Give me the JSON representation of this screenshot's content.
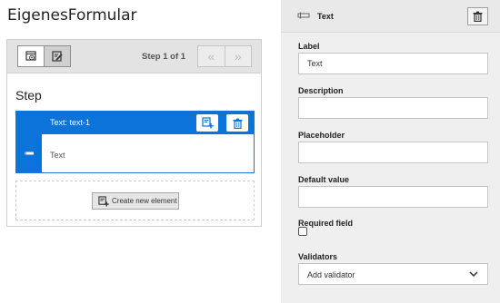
{
  "form": {
    "title": "EigenesFormular"
  },
  "stage": {
    "step_counter": "Step 1 of 1",
    "prev_label": "«",
    "next_label": "»",
    "step_title": "Step",
    "element": {
      "label": "Text: text-1",
      "value": "Text"
    },
    "create_button": "Create new element"
  },
  "inspector": {
    "title": "Text",
    "fields": {
      "label": {
        "label": "Label",
        "value": "Text"
      },
      "description": {
        "label": "Description",
        "value": ""
      },
      "placeholder": {
        "label": "Placeholder",
        "value": ""
      },
      "default_value": {
        "label": "Default value",
        "value": ""
      },
      "required": {
        "label": "Required field"
      },
      "validators": {
        "label": "Validators",
        "selected": "Add validator"
      }
    }
  },
  "colors": {
    "accent": "#0b73d9",
    "panel_bg": "#efefef",
    "toolbar_bg": "#e3e3e3"
  },
  "icons": [
    "preview-icon",
    "edit-icon",
    "add-element-icon",
    "trash-icon",
    "text-element-icon",
    "chevron-down-icon"
  ]
}
